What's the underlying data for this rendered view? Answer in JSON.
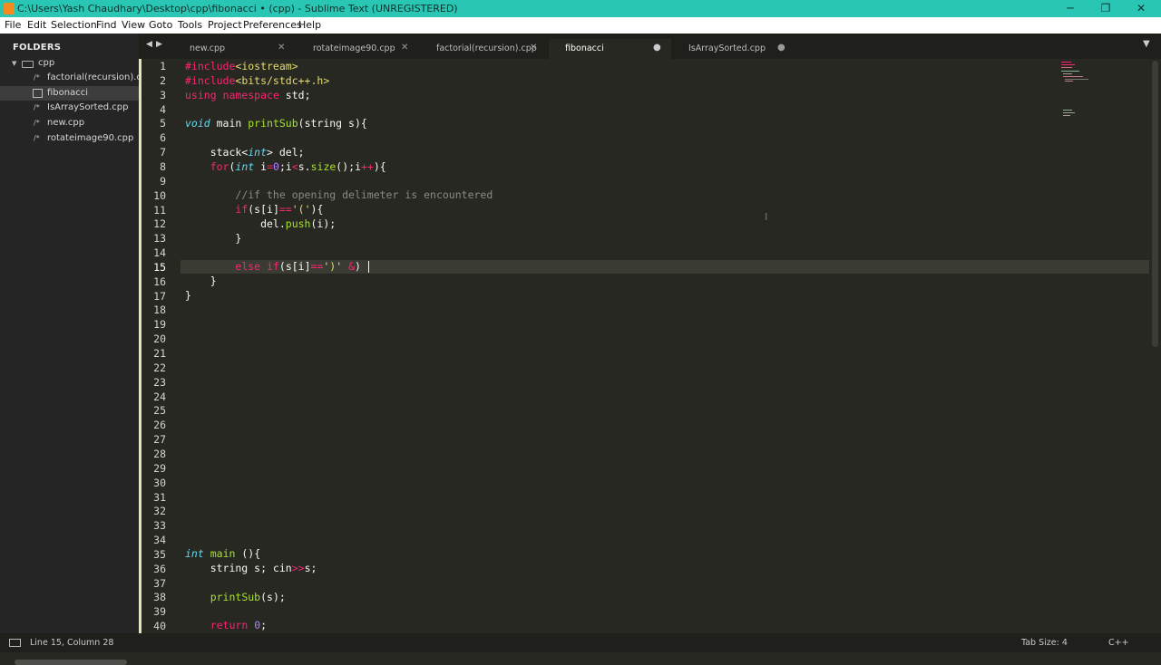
{
  "window": {
    "title": "C:\\Users\\Yash Chaudhary\\Desktop\\cpp\\fibonacci • (cpp) - Sublime Text (UNREGISTERED)",
    "minimize": "─",
    "restore": "❐",
    "close": "✕"
  },
  "menu": [
    "File",
    "Edit",
    "Selection",
    "Find",
    "View",
    "Goto",
    "Tools",
    "Project",
    "Preferences",
    "Help"
  ],
  "sidebar": {
    "header": "FOLDERS",
    "folder": "cpp",
    "files": [
      "factorial(recursion).cpp",
      "fibonacci",
      "IsArraySorted.cpp",
      "new.cpp",
      "rotateimage90.cpp"
    ],
    "selected_index": 1,
    "nav_left": "◀",
    "nav_right": "▶"
  },
  "tabs": [
    {
      "label": "new.cpp",
      "close": "✕"
    },
    {
      "label": "rotateimage90.cpp",
      "close": "✕"
    },
    {
      "label": "factorial(recursion).cpp",
      "close": "✕"
    },
    {
      "label": "fibonacci",
      "close": "●"
    },
    {
      "label": "IsArraySorted.cpp",
      "close": "●"
    }
  ],
  "tab_dropdown": "▼",
  "editor": {
    "current_line": 15,
    "line_numbers": [
      "1",
      "2",
      "3",
      "4",
      "5",
      "6",
      "7",
      "8",
      "9",
      "10",
      "11",
      "12",
      "13",
      "14",
      "15",
      "16",
      "17",
      "18",
      "19",
      "20",
      "21",
      "22",
      "23",
      "24",
      "25",
      "26",
      "27",
      "28",
      "29",
      "30",
      "31",
      "32",
      "33",
      "34",
      "35",
      "36",
      "37",
      "38",
      "39",
      "40"
    ]
  },
  "status": {
    "position": "Line 15, Column 28",
    "tab_size": "Tab Size: 4",
    "syntax": "C++"
  },
  "colors": {
    "titlebar": "#2ac6b4",
    "editor_bg": "#272822",
    "keyword": "#f92672",
    "type": "#66d9ef",
    "function": "#a6e22e",
    "number": "#ae81ff",
    "string": "#e6db74"
  }
}
